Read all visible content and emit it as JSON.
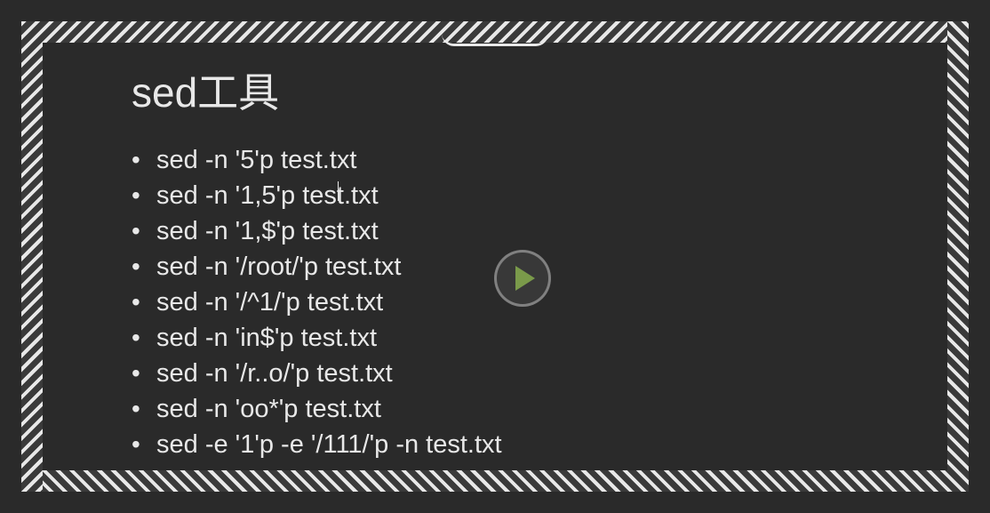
{
  "slide": {
    "title": "sed工具",
    "bullets": [
      "sed -n '5'p test.txt",
      "sed -n '1,5'p test.txt",
      "sed -n '1,$'p test.txt",
      "sed -n '/root/'p test.txt",
      "sed -n '/^1/'p test.txt",
      "sed -n 'in$'p test.txt",
      "sed -n '/r..o/'p test.txt",
      "sed -n 'oo*'p test.txt",
      "sed -e '1'p -e '/111/'p -n test.txt"
    ]
  },
  "controls": {
    "play": "play"
  }
}
